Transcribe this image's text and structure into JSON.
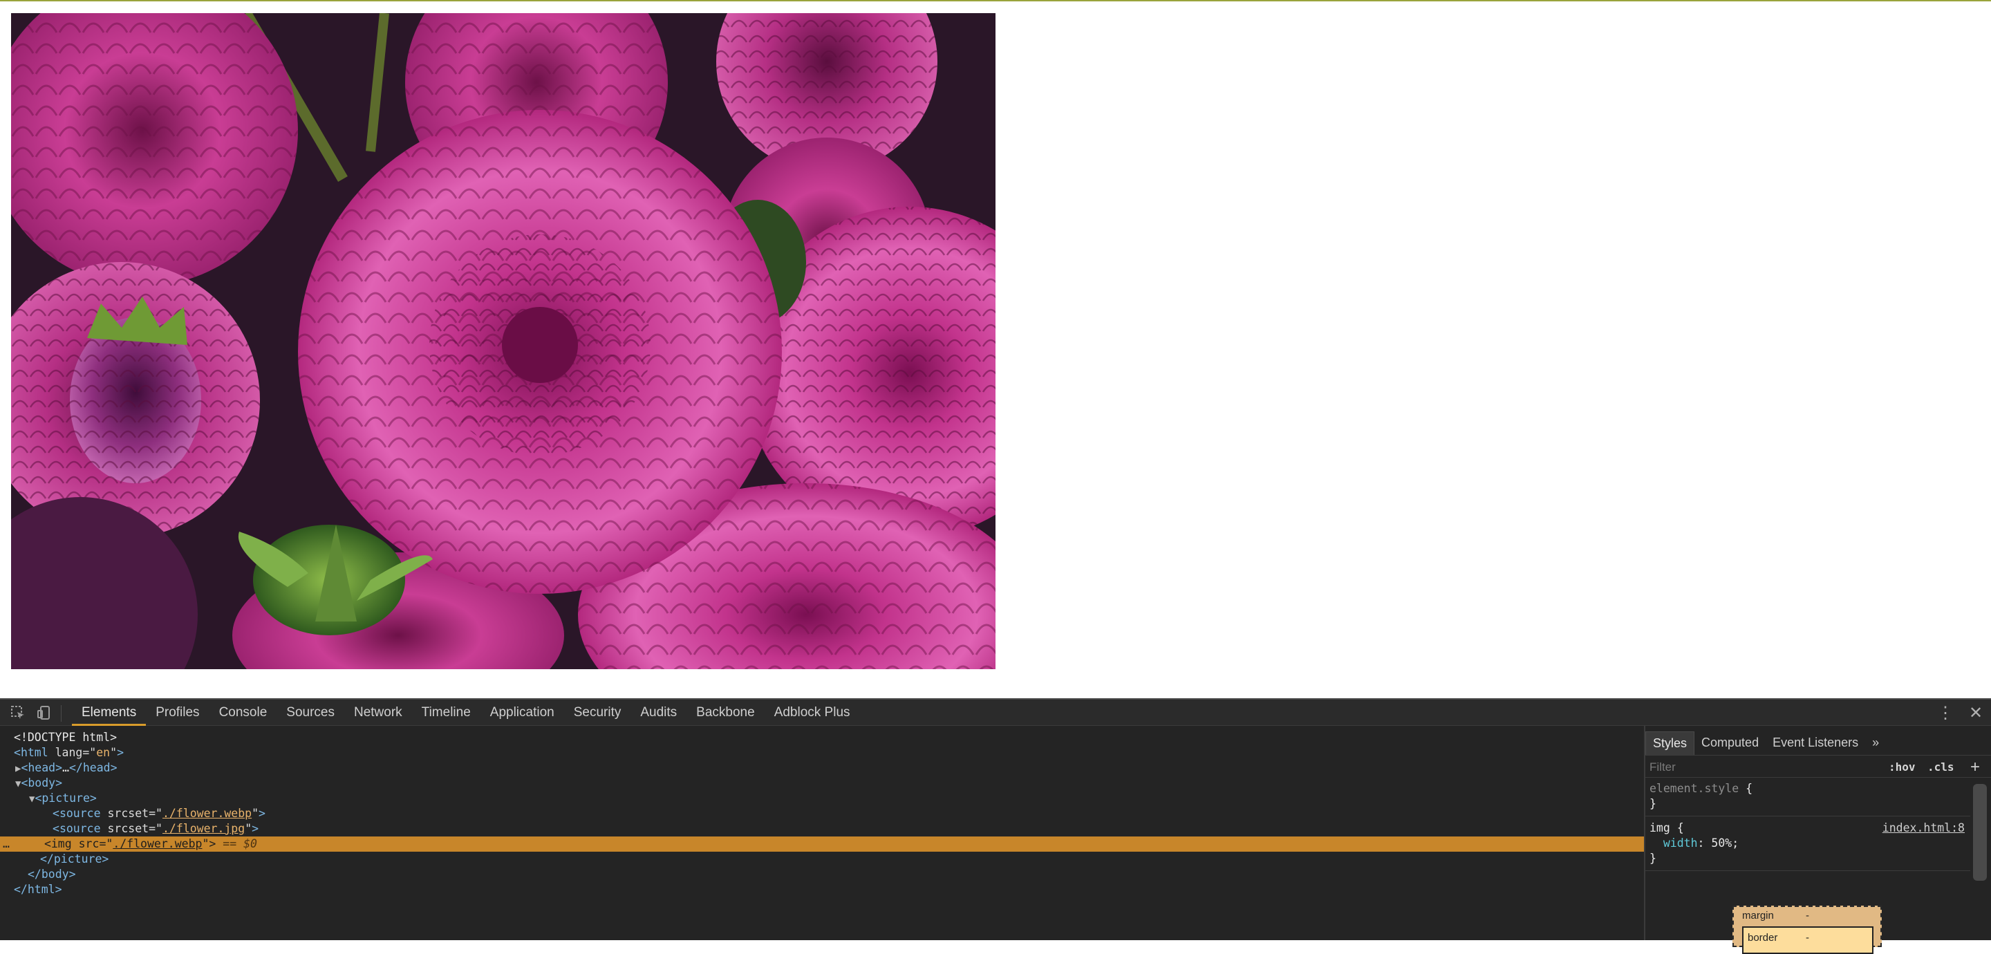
{
  "devtools": {
    "tabs": [
      "Elements",
      "Profiles",
      "Console",
      "Sources",
      "Network",
      "Timeline",
      "Application",
      "Security",
      "Audits",
      "Backbone",
      "Adblock Plus"
    ],
    "active_tab": "Elements",
    "icons": {
      "inspect": "inspect-element-icon",
      "device": "device-mode-icon",
      "menu": "more-options-icon",
      "close": "close-icon"
    },
    "dom": {
      "doctype": "<!DOCTYPE html>",
      "html_open_tag": "html",
      "html_lang_attr": "lang",
      "html_lang_val": "en",
      "head_collapsed": "…",
      "head_tag": "head",
      "body_tag": "body",
      "picture_tag": "picture",
      "source_tag": "source",
      "srcset_attr": "srcset",
      "source1_val": "./flower.webp",
      "source2_val": "./flower.jpg",
      "img_tag": "img",
      "img_src_attr": "src",
      "img_src_val": "./flower.webp",
      "selected_suffix": "== $0",
      "ellipsis": "…"
    },
    "styles": {
      "tabs": [
        "Styles",
        "Computed",
        "Event Listeners"
      ],
      "more_tabs": "»",
      "filter_placeholder": "Filter",
      "hov": ":hov",
      "cls": ".cls",
      "add": "+",
      "element_style": "element.style",
      "rule_selector": "img",
      "rule_source": "index.html:8",
      "rule_prop": "width",
      "rule_value": "50%;",
      "boxmodel": {
        "margin_label": "margin",
        "margin_value": "-",
        "border_label": "border",
        "border_value": "-"
      }
    }
  },
  "page": {
    "image_alt": "pink dahlia flowers"
  },
  "colors": {
    "accent": "#d99c2b",
    "selected_row": "#c8862a",
    "devtools_bg": "#242424"
  }
}
